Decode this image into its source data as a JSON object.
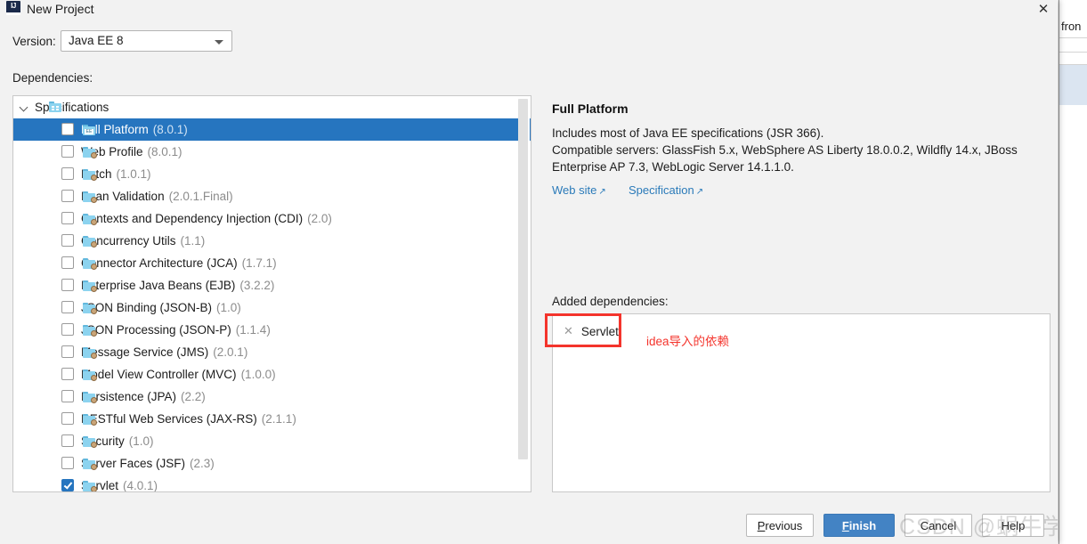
{
  "window": {
    "title": "New Project",
    "app_icon": "intellij-idea-icon",
    "close_icon": "close-icon"
  },
  "version_row": {
    "label": "Version:",
    "selected": "Java EE 8",
    "options": [
      "Java EE 8"
    ]
  },
  "dependencies": {
    "label": "Dependencies:",
    "tree": {
      "group": {
        "label": "Specifications",
        "expanded": true
      },
      "items": [
        {
          "name": "Full Platform",
          "version": "(8.0.1)",
          "checked": false,
          "selected": true,
          "icon": "ee-spec-icon"
        },
        {
          "name": "Web Profile",
          "version": "(8.0.1)",
          "checked": false,
          "selected": false,
          "icon": "spec-icon"
        },
        {
          "name": "Batch",
          "version": "(1.0.1)",
          "checked": false,
          "selected": false,
          "icon": "spec-icon"
        },
        {
          "name": "Bean Validation",
          "version": "(2.0.1.Final)",
          "checked": false,
          "selected": false,
          "icon": "spec-icon"
        },
        {
          "name": "Contexts and Dependency Injection (CDI)",
          "version": "(2.0)",
          "checked": false,
          "selected": false,
          "icon": "spec-icon"
        },
        {
          "name": "Concurrency Utils",
          "version": "(1.1)",
          "checked": false,
          "selected": false,
          "icon": "spec-icon"
        },
        {
          "name": "Connector Architecture (JCA)",
          "version": "(1.7.1)",
          "checked": false,
          "selected": false,
          "icon": "spec-icon"
        },
        {
          "name": "Enterprise Java Beans (EJB)",
          "version": "(3.2.2)",
          "checked": false,
          "selected": false,
          "icon": "spec-icon"
        },
        {
          "name": "JSON Binding (JSON-B)",
          "version": "(1.0)",
          "checked": false,
          "selected": false,
          "icon": "spec-icon"
        },
        {
          "name": "JSON Processing (JSON-P)",
          "version": "(1.1.4)",
          "checked": false,
          "selected": false,
          "icon": "spec-icon"
        },
        {
          "name": "Message Service (JMS)",
          "version": "(2.0.1)",
          "checked": false,
          "selected": false,
          "icon": "spec-icon"
        },
        {
          "name": "Model View Controller (MVC)",
          "version": "(1.0.0)",
          "checked": false,
          "selected": false,
          "icon": "spec-icon"
        },
        {
          "name": "Persistence (JPA)",
          "version": "(2.2)",
          "checked": false,
          "selected": false,
          "icon": "spec-icon"
        },
        {
          "name": "RESTful Web Services (JAX-RS)",
          "version": "(2.1.1)",
          "checked": false,
          "selected": false,
          "icon": "spec-icon"
        },
        {
          "name": "Security",
          "version": "(1.0)",
          "checked": false,
          "selected": false,
          "icon": "spec-icon"
        },
        {
          "name": "Server Faces (JSF)",
          "version": "(2.3)",
          "checked": false,
          "selected": false,
          "icon": "spec-icon"
        },
        {
          "name": "Servlet",
          "version": "(4.0.1)",
          "checked": true,
          "selected": false,
          "icon": "spec-icon"
        }
      ]
    }
  },
  "info": {
    "title": "Full Platform",
    "description_line1": "Includes most of Java EE specifications (JSR 366).",
    "description_line2": "Compatible servers: GlassFish 5.x, WebSphere AS Liberty 18.0.0.2, Wildfly 14.x, JBoss",
    "description_line3": "Enterprise AP 7.3, WebLogic Server 14.1.1.0.",
    "links": [
      {
        "label": "Web site",
        "icon": "external-link-icon"
      },
      {
        "label": "Specification",
        "icon": "external-link-icon"
      }
    ]
  },
  "added": {
    "label": "Added dependencies:",
    "chips": [
      {
        "label": "Servlet",
        "remove_icon": "close-icon"
      }
    ]
  },
  "annotation": {
    "text": "idea导入的依赖",
    "color": "#f4342c"
  },
  "footer": {
    "previous": {
      "prefix": "P",
      "rest": "revious"
    },
    "finish": {
      "prefix": "F",
      "rest": "inish"
    },
    "cancel": {
      "prefix": "C",
      "rest": "ancel"
    },
    "help": {
      "prefix": "H",
      "rest": "elp"
    }
  },
  "watermark": "CSDN @蜗牛学苑_武汉",
  "background_window": {
    "text": "fron"
  },
  "colors": {
    "selection_blue": "#2675bf",
    "primary_button": "#4383c4",
    "link_blue": "#2a7ab9",
    "annotation_red": "#f4342c",
    "dialog_bg": "#f2f2f2"
  }
}
